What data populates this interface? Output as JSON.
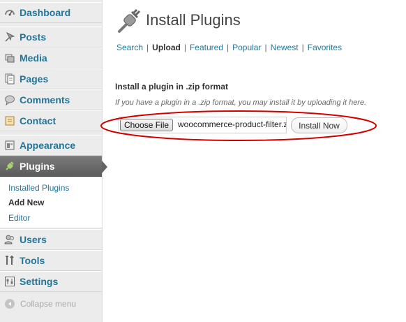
{
  "sidebar": {
    "menu": [
      {
        "label": "Dashboard",
        "icon": "dashboard-icon"
      },
      {
        "label": "Posts",
        "icon": "posts-pin-icon"
      },
      {
        "label": "Media",
        "icon": "media-icon"
      },
      {
        "label": "Pages",
        "icon": "pages-icon"
      },
      {
        "label": "Comments",
        "icon": "comments-icon"
      },
      {
        "label": "Contact",
        "icon": "contact-icon"
      },
      {
        "label": "Appearance",
        "icon": "appearance-icon"
      },
      {
        "label": "Plugins",
        "icon": "plugins-icon"
      },
      {
        "label": "Users",
        "icon": "users-icon"
      },
      {
        "label": "Tools",
        "icon": "tools-icon"
      },
      {
        "label": "Settings",
        "icon": "settings-icon"
      }
    ],
    "submenu": [
      {
        "label": "Installed Plugins"
      },
      {
        "label": "Add New"
      },
      {
        "label": "Editor"
      }
    ],
    "collapse_label": "Collapse menu"
  },
  "main": {
    "title": "Install Plugins",
    "tabs": [
      {
        "label": "Search"
      },
      {
        "label": "Upload"
      },
      {
        "label": "Featured"
      },
      {
        "label": "Popular"
      },
      {
        "label": "Newest"
      },
      {
        "label": "Favorites"
      }
    ],
    "current_tab": "Upload",
    "upload": {
      "heading": "Install a plugin in .zip format",
      "description": "If you have a plugin in a .zip format, you may install it by uploading it here.",
      "choose_file_label": "Choose File",
      "file_name": "woocommerce-product-filter.zip",
      "install_label": "Install Now"
    }
  },
  "colors": {
    "link": "#21759b",
    "active_menu_bg": "#636363",
    "annotation": "#d40000"
  }
}
